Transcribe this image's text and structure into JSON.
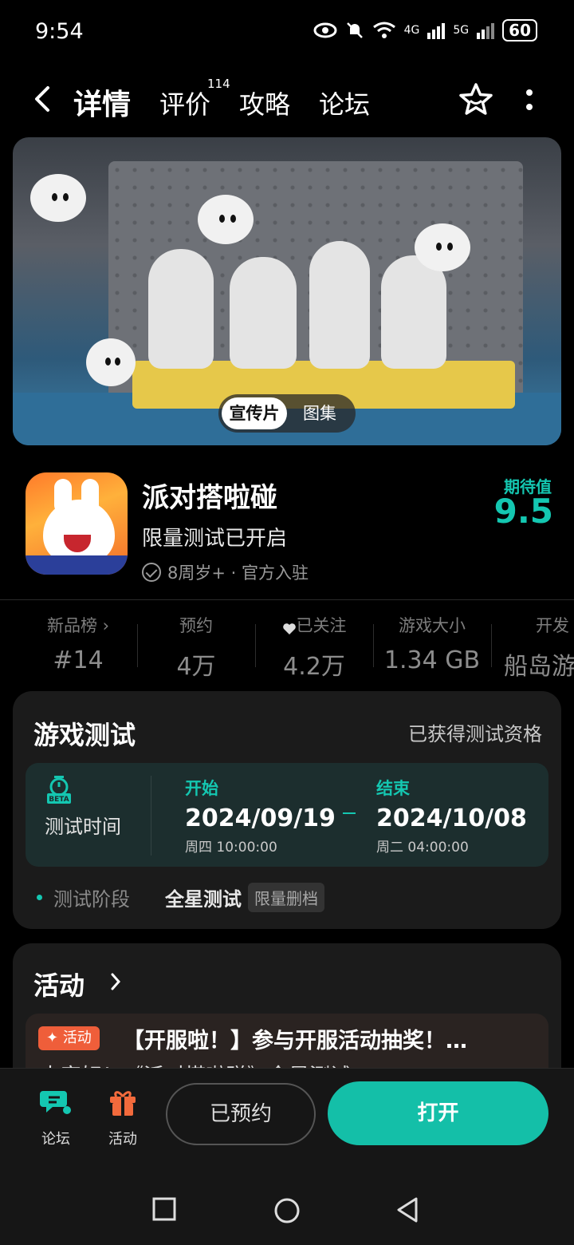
{
  "status_bar": {
    "time": "9:54",
    "network1": "4G",
    "network2": "5G",
    "battery": "60"
  },
  "nav": {
    "tabs": [
      {
        "label": "详情"
      },
      {
        "label": "评价"
      },
      {
        "label": "攻略"
      },
      {
        "label": "论坛"
      }
    ],
    "review_count": "114"
  },
  "hero": {
    "segments": [
      "宣传片",
      "图集"
    ]
  },
  "app": {
    "name": "派对搭啦碰",
    "subtitle": "限量测试已开启",
    "meta": "8周岁+ · 官方入驻",
    "score_label": "期待值",
    "score": "9.5"
  },
  "stats": [
    {
      "label": "新品榜 ›",
      "value": "#14"
    },
    {
      "label": "预约",
      "value": "4万"
    },
    {
      "label": "已关注",
      "value": "4.2万"
    },
    {
      "label": "游戏大小",
      "value": "1.34 GB"
    },
    {
      "label": "开发",
      "value": "船岛游"
    }
  ],
  "test_card": {
    "title": "游戏测试",
    "status": "已获得测试资格",
    "time_label": "测试时间",
    "start_label": "开始",
    "start_date": "2024/09/19",
    "start_time": "周四  10:00:00",
    "end_label": "结束",
    "end_date": "2024/10/08",
    "end_time": "周二  04:00:00",
    "phase_label": "测试阶段",
    "phase_value": "全星测试",
    "phase_tag": "限量删档",
    "beta_badge": "BETA"
  },
  "activity": {
    "title": "活动",
    "badge": "活动",
    "headline": "【开服啦！】参与开服活动抽奖！…",
    "preview": "大家好！《派对搭啦碰》全星测试"
  },
  "bottom_bar": {
    "forum": "论坛",
    "activity": "活动",
    "reserved": "已预约",
    "open": "打开"
  },
  "colors": {
    "accent": "#14c7b1",
    "activity": "#ef5e3a"
  }
}
